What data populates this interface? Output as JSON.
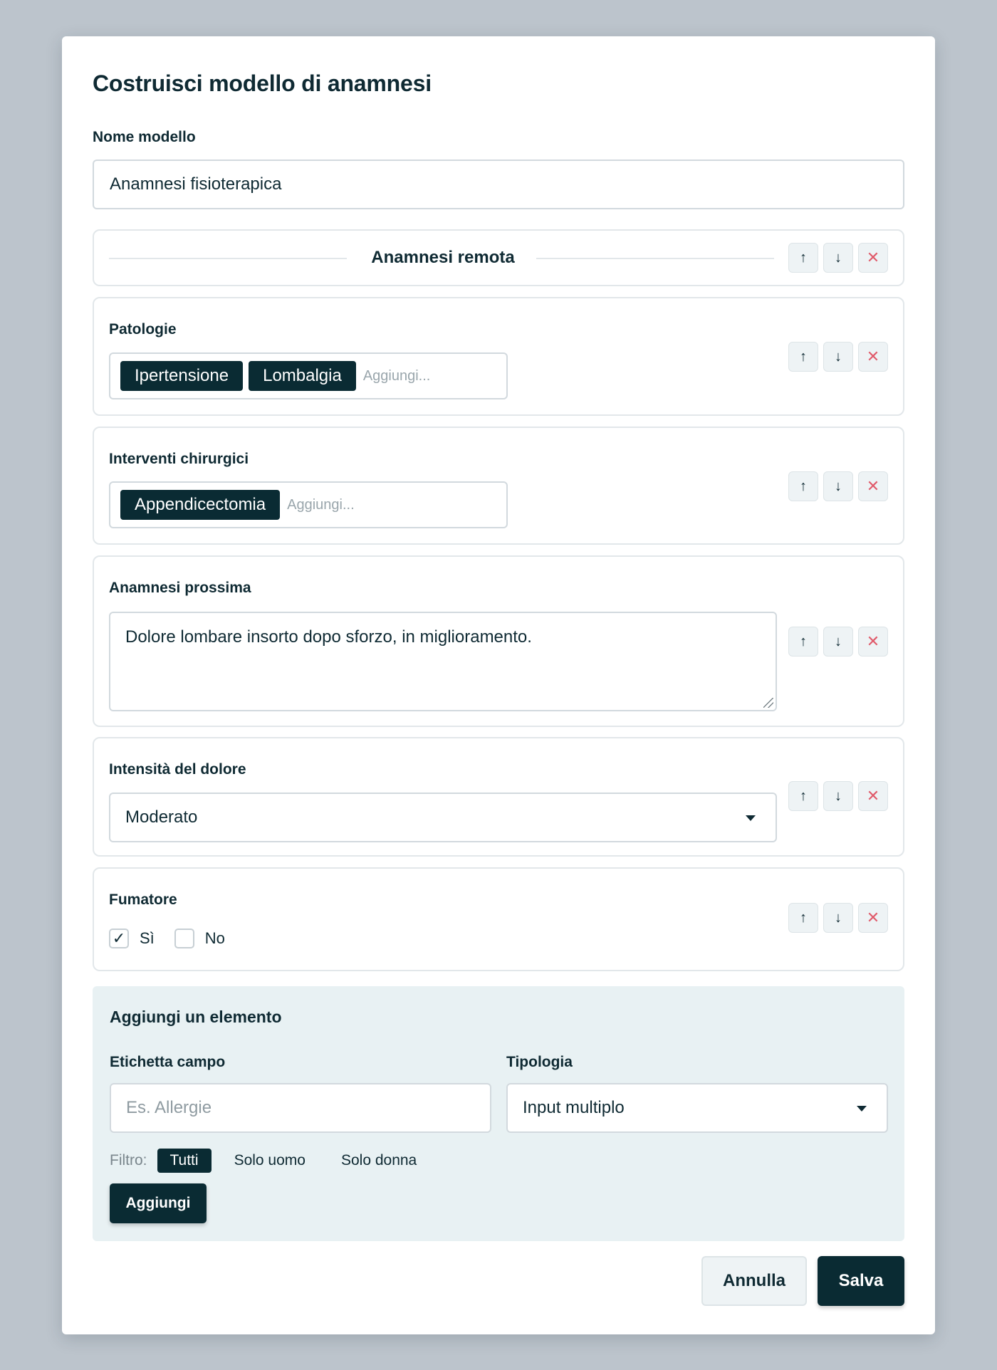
{
  "modal": {
    "title": "Costruisci modello di anamnesi",
    "name_label": "Nome modello",
    "name_value": "Anamnesi fisioterapica"
  },
  "controls": {
    "up_icon": "↑",
    "down_icon": "↓",
    "delete_icon": "✕"
  },
  "section": {
    "title": "Anamnesi remota"
  },
  "fields": {
    "patologie": {
      "label": "Patologie",
      "tags": [
        "Ipertensione",
        "Lombalgia"
      ],
      "placeholder": "Aggiungi..."
    },
    "interventi": {
      "label": "Interventi chirurgici",
      "tags": [
        "Appendicectomia"
      ],
      "placeholder": "Aggiungi..."
    },
    "prossima": {
      "label": "Anamnesi prossima",
      "value": "Dolore lombare insorto dopo sforzo, in miglioramento."
    },
    "dolore": {
      "label": "Intensità del dolore",
      "value": "Moderato"
    },
    "fumatore": {
      "label": "Fumatore",
      "options": [
        {
          "label": "Sì",
          "checked": true
        },
        {
          "label": "No",
          "checked": false
        }
      ]
    }
  },
  "add_panel": {
    "title": "Aggiungi un elemento",
    "label_field": "Etichetta campo",
    "label_placeholder": "Es. Allergie",
    "type_label": "Tipologia",
    "type_value": "Input multiplo",
    "filter_label": "Filtro:",
    "filters": [
      {
        "label": "Tutti",
        "active": true
      },
      {
        "label": "Solo uomo",
        "active": false
      },
      {
        "label": "Solo donna",
        "active": false
      }
    ],
    "add_button": "Aggiungi"
  },
  "footer": {
    "cancel": "Annulla",
    "save": "Salva"
  }
}
